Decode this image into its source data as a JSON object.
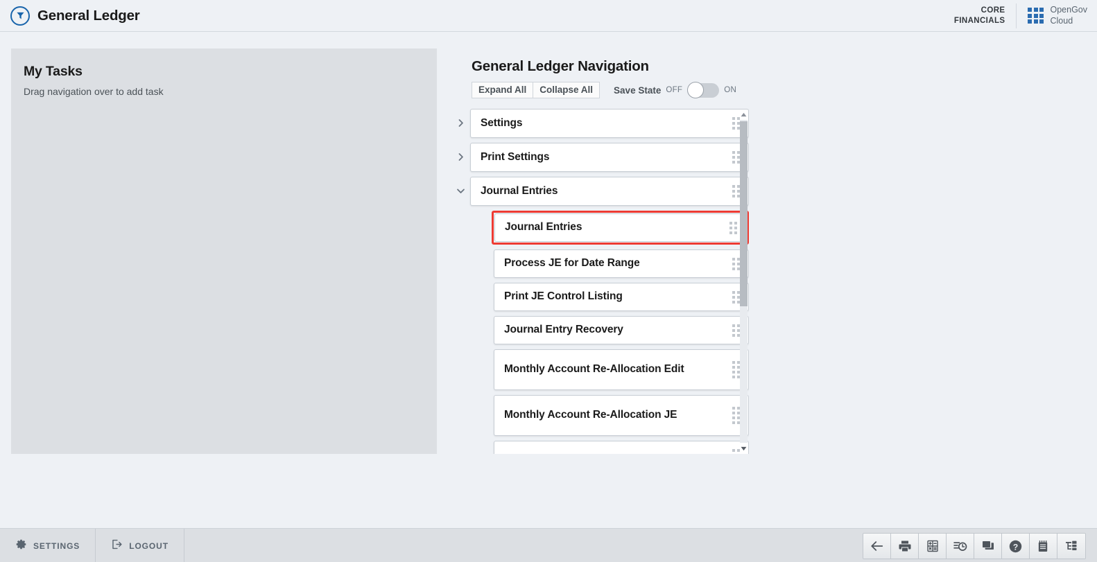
{
  "header": {
    "logo_icon": "funnel-circle-icon",
    "app_title": "General Ledger",
    "brand_core_line1": "CORE",
    "brand_core_line2": "FINANCIALS",
    "brand_og_line1": "OpenGov",
    "brand_og_line2": "Cloud",
    "grid_icon": "apps-grid-icon",
    "accent_color": "#2b6cb0"
  },
  "my_tasks": {
    "title": "My Tasks",
    "subtitle": "Drag navigation over to add task"
  },
  "navigation": {
    "title": "General Ledger Navigation",
    "expand_all_label": "Expand All",
    "collapse_all_label": "Collapse All",
    "save_state_label": "Save State",
    "toggle_off_label": "OFF",
    "toggle_on_label": "ON",
    "toggle_state": "off",
    "selected_color": "#ee3b33",
    "groups": [
      {
        "label": "Settings",
        "expanded": false,
        "chevron": "chevron-right-icon"
      },
      {
        "label": "Print Settings",
        "expanded": false,
        "chevron": "chevron-right-icon"
      },
      {
        "label": "Journal Entries",
        "expanded": true,
        "chevron": "chevron-down-icon"
      }
    ],
    "children": [
      {
        "label": "Journal Entries",
        "selected": true,
        "lines": 1
      },
      {
        "label": "Process JE for Date Range",
        "selected": false,
        "lines": 1
      },
      {
        "label": "Print JE Control Listing",
        "selected": false,
        "lines": 1
      },
      {
        "label": "Journal Entry Recovery",
        "selected": false,
        "lines": 1
      },
      {
        "label": "Monthly Account Re-Allocation Edit",
        "selected": false,
        "lines": 2
      },
      {
        "label": "Monthly Account Re-Allocation JE",
        "selected": false,
        "lines": 2
      },
      {
        "label": "",
        "selected": false,
        "lines": 1
      }
    ],
    "scroll": {
      "up_arrow_icon": "scroll-up-arrow-icon",
      "down_arrow_icon": "scroll-down-arrow-icon"
    }
  },
  "footer": {
    "settings_label": "SETTINGS",
    "settings_icon": "gear-icon",
    "logout_label": "LOGOUT",
    "logout_icon": "logout-icon",
    "toolbar_icons": [
      "back-arrow-icon",
      "printer-icon",
      "calculator-icon",
      "schedule-clock-icon",
      "stacked-windows-icon",
      "help-question-icon",
      "notepad-icon",
      "tree-view-icon"
    ]
  }
}
